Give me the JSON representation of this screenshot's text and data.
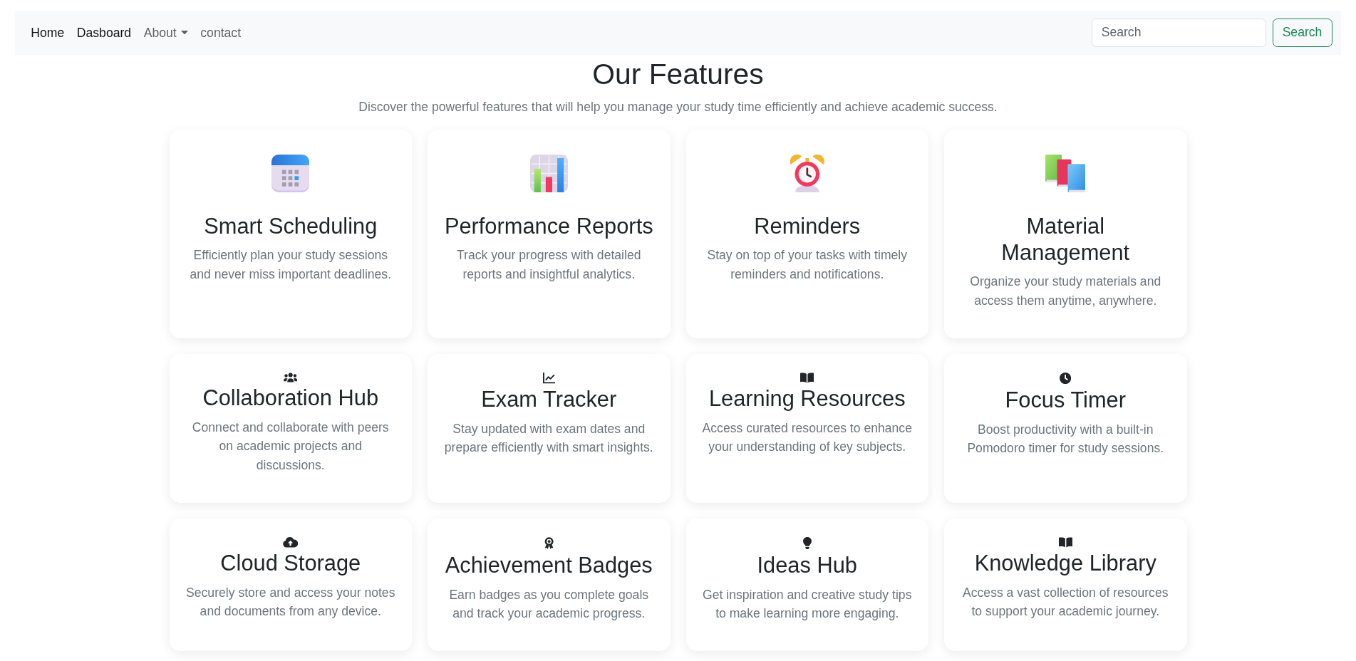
{
  "navbar": {
    "links": [
      {
        "label": "Home",
        "kind": "link",
        "active": true
      },
      {
        "label": "Dasboard",
        "kind": "link",
        "active": true
      },
      {
        "label": "About",
        "kind": "dropdown",
        "active": false
      },
      {
        "label": "contact",
        "kind": "link",
        "active": false
      }
    ],
    "search": {
      "placeholder": "Search"
    },
    "search_button": {
      "label": "Search"
    }
  },
  "header": {
    "title": "Our Features",
    "subtitle": "Discover the powerful features that will help you manage your study time efficiently and achieve academic success."
  },
  "features": [
    {
      "kind": "emoji",
      "title": "Smart Scheduling",
      "description": "Efficiently plan your study sessions and never miss important deadlines."
    },
    {
      "kind": "emoji",
      "title": "Performance Reports",
      "description": "Track your progress with detailed reports and insightful analytics."
    },
    {
      "kind": "emoji",
      "title": "Reminders",
      "description": "Stay on top of your tasks with timely reminders and notifications."
    },
    {
      "kind": "emoji",
      "title": "Material Management",
      "description": "Organize your study materials and access them anytime, anywhere."
    },
    {
      "kind": "glyph",
      "title": "Collaboration Hub",
      "description": "Connect and collaborate with peers on academic projects and discussions."
    },
    {
      "kind": "glyph",
      "title": "Exam Tracker",
      "description": "Stay updated with exam dates and prepare efficiently with smart insights."
    },
    {
      "kind": "glyph",
      "title": "Learning Resources",
      "description": "Access curated resources to enhance your understanding of key subjects."
    },
    {
      "kind": "glyph",
      "title": "Focus Timer",
      "description": "Boost productivity with a built-in Pomodoro timer for study sessions."
    },
    {
      "kind": "glyph",
      "title": "Cloud Storage",
      "description": "Securely store and access your notes and documents from any device."
    },
    {
      "kind": "glyph",
      "title": "Achievement Badges",
      "description": "Earn badges as you complete goals and track your academic progress."
    },
    {
      "kind": "glyph",
      "title": "Ideas Hub",
      "description": "Get inspiration and creative study tips to make learning more engaging."
    },
    {
      "kind": "glyph",
      "title": "Knowledge Library",
      "description": "Access a vast collection of resources to support your academic journey."
    }
  ]
}
